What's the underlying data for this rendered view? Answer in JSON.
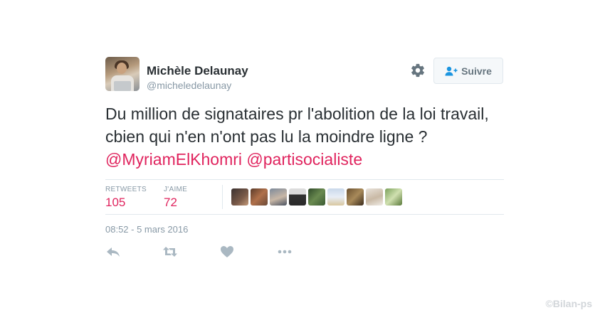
{
  "tweet": {
    "author_name": "Michèle Delaunay",
    "author_handle": "@micheledelaunay",
    "follow_label": "Suivre",
    "text_plain": "Du million de signataires pr l'abolition de la loi travail, cbien qui n'en n'ont pas lu la moindre ligne ? ",
    "mention_1": "@MyriamElKhomri",
    "mention_2": "@partisocialiste",
    "retweets_label": "RETWEETS",
    "retweets_count": "105",
    "likes_label": "J'AIME",
    "likes_count": "72",
    "timestamp": "08:52 - 5 mars 2016",
    "accent_color": "#e0245e"
  },
  "icons": {
    "settings": "gear-icon",
    "follow": "add-user-icon",
    "reply": "reply-icon",
    "retweet": "retweet-icon",
    "like": "heart-icon",
    "more": "more-icon"
  },
  "likers_count": 9,
  "watermark": "©Bilan-ps"
}
